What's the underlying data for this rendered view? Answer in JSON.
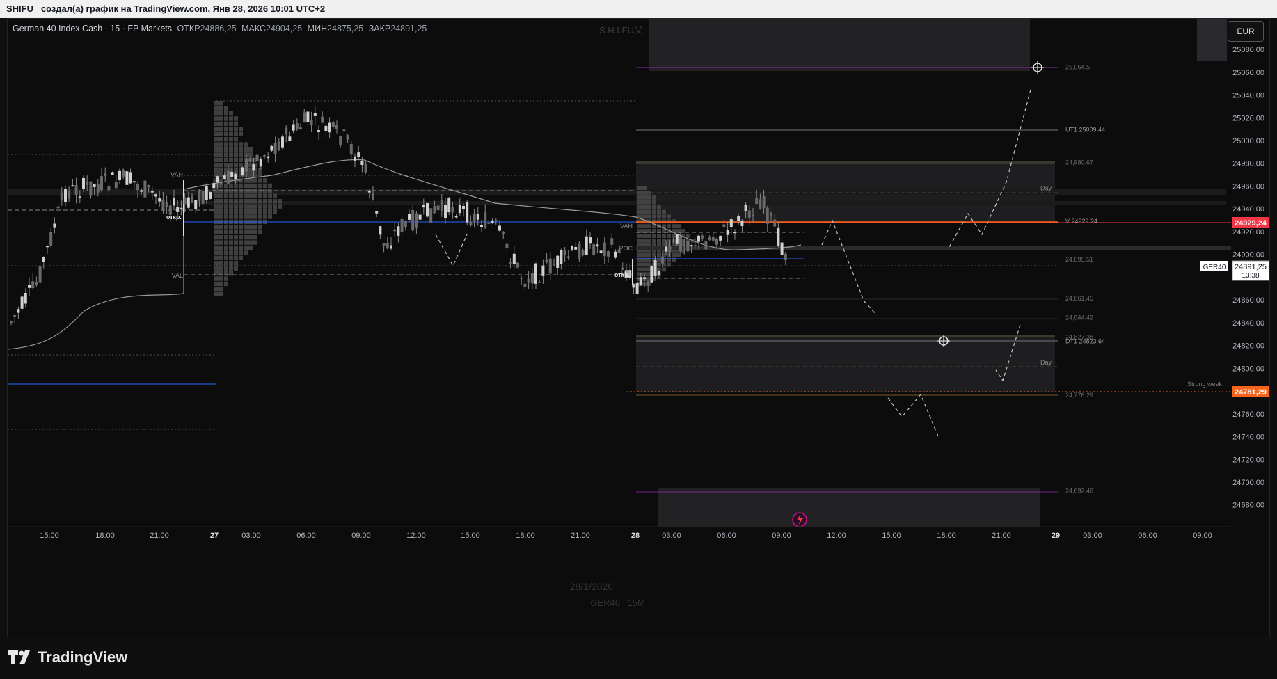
{
  "window_title": "SHIFU_ создал(а) график на TradingView.com, Янв 28, 2026 10:01 UTC+2",
  "legend": {
    "symbol": "German 40 Index Cash · 15 · FP Markets",
    "open_label": "ОТКР",
    "open": "24886,25",
    "high_label": "МАКС",
    "high": "24904,25",
    "low_label": "МИН",
    "low": "24875,25",
    "close_label": "ЗАКР",
    "close": "24891,25"
  },
  "author_tag": "S.H.I.FU父",
  "currency_button": "EUR",
  "price_axis": {
    "ticks": [
      "25080,00",
      "25060,00",
      "25040,00",
      "25020,00",
      "25000,00",
      "24980,00",
      "24960,00",
      "24940,00",
      "24920,00",
      "24900,00",
      "24880,00",
      "24860,00",
      "24840,00",
      "24820,00",
      "24800,00",
      "24780,00",
      "24760,00",
      "24740,00",
      "24720,00",
      "24700,00",
      "24680,00"
    ],
    "tick_values": [
      25080,
      25060,
      25040,
      25020,
      25000,
      24980,
      24960,
      24940,
      24920,
      24900,
      24880,
      24860,
      24840,
      24820,
      24800,
      24780,
      24760,
      24740,
      24720,
      24700,
      24680
    ],
    "current_price": "24891,25",
    "countdown": "13:38",
    "symbol_tag": "GER40",
    "red_label": "24929,24",
    "orange_label": "24781,29"
  },
  "time_axis": {
    "labels": [
      "15:00",
      "18:00",
      "21:00",
      "27",
      "03:00",
      "06:00",
      "09:00",
      "12:00",
      "15:00",
      "18:00",
      "21:00",
      "28",
      "03:00",
      "06:00",
      "09:00",
      "12:00",
      "15:00",
      "18:00",
      "21:00",
      "29",
      "03:00",
      "06:00",
      "09:00"
    ]
  },
  "levels": [
    {
      "text": "25,064.5",
      "value": 25064.5
    },
    {
      "text": "UT1 25009.44",
      "value": 25009.44
    },
    {
      "text": "24,980.67",
      "value": 24980.67
    },
    {
      "text": "Day",
      "value": 24958
    },
    {
      "text": "V 24929.24",
      "value": 24929.24
    },
    {
      "text": "24,895.51",
      "value": 24895.51
    },
    {
      "text": "24,861.45",
      "value": 24861.45
    },
    {
      "text": "24,844.42",
      "value": 24844.42
    },
    {
      "text": "24,827.38",
      "value": 24827.38
    },
    {
      "text": "DT1 24823.64",
      "value": 24823.64
    },
    {
      "text": "Day",
      "value": 24805
    },
    {
      "text": "Strong week",
      "value": 24786
    },
    {
      "text": "24,776.29",
      "value": 24776.29
    },
    {
      "text": "24,692.46",
      "value": 24692.46
    }
  ],
  "profile_labels": {
    "vah": "VAH",
    "val": "VAL",
    "poc": "POC",
    "open": "откр."
  },
  "watermark_date": "28/1/2026",
  "watermark_symbol": "GER40 | 15M",
  "brand": "TradingView",
  "colors": {
    "red": "#f23645",
    "orange": "#f7631b",
    "blue": "#2962ff",
    "purple": "#9c27b0",
    "bg": "#0c0c0c"
  }
}
